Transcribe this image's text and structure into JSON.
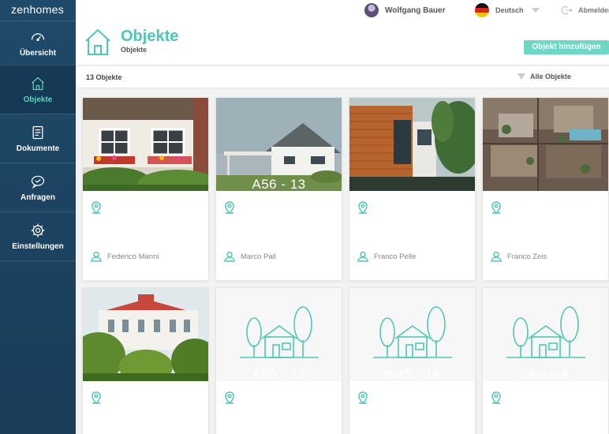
{
  "app": {
    "logo": "zenhomes"
  },
  "sidebar": {
    "items": [
      {
        "label": "Übersicht",
        "icon": "speedometer-icon"
      },
      {
        "label": "Objekte",
        "icon": "house-icon",
        "active": true
      },
      {
        "label": "Dokumente",
        "icon": "document-icon"
      },
      {
        "label": "Anfragen",
        "icon": "chat-icon"
      },
      {
        "label": "Einstellungen",
        "icon": "gear-icon"
      }
    ]
  },
  "topbar": {
    "user_name": "Wolfgang Bauer",
    "language": "Deutsch",
    "logout": "Abmelden"
  },
  "page": {
    "title": "Objekte",
    "breadcrumb": "Objekte",
    "add_button": "Objekt hinzufügen",
    "count": "13 Objekte",
    "filter": "Alle Objekte"
  },
  "colors": {
    "accent": "#4fc6b6",
    "button": "#6fd6c6",
    "sidebar": "#1f4a6a"
  },
  "cards": [
    {
      "overlay": "",
      "owner": "Federico Manni",
      "image": "photo-townhouse"
    },
    {
      "overlay": "A56 - 13",
      "owner": "Marco Pall",
      "image": "photo-modern-house"
    },
    {
      "overlay": "",
      "owner": "Franco Pelle",
      "image": "photo-wood-facade"
    },
    {
      "overlay": "",
      "owner": "Franco Zeis",
      "image": "photo-rooftop-aerial"
    },
    {
      "overlay": "",
      "owner": "",
      "image": "photo-villa"
    },
    {
      "overlay": "A56 - 13",
      "owner": "",
      "image": "house-placeholder"
    },
    {
      "overlay": "W45 - 16",
      "owner": "",
      "image": "house-placeholder"
    },
    {
      "overlay": "Strasse",
      "overlay_top": "…",
      "owner": "",
      "image": "house-placeholder"
    }
  ]
}
